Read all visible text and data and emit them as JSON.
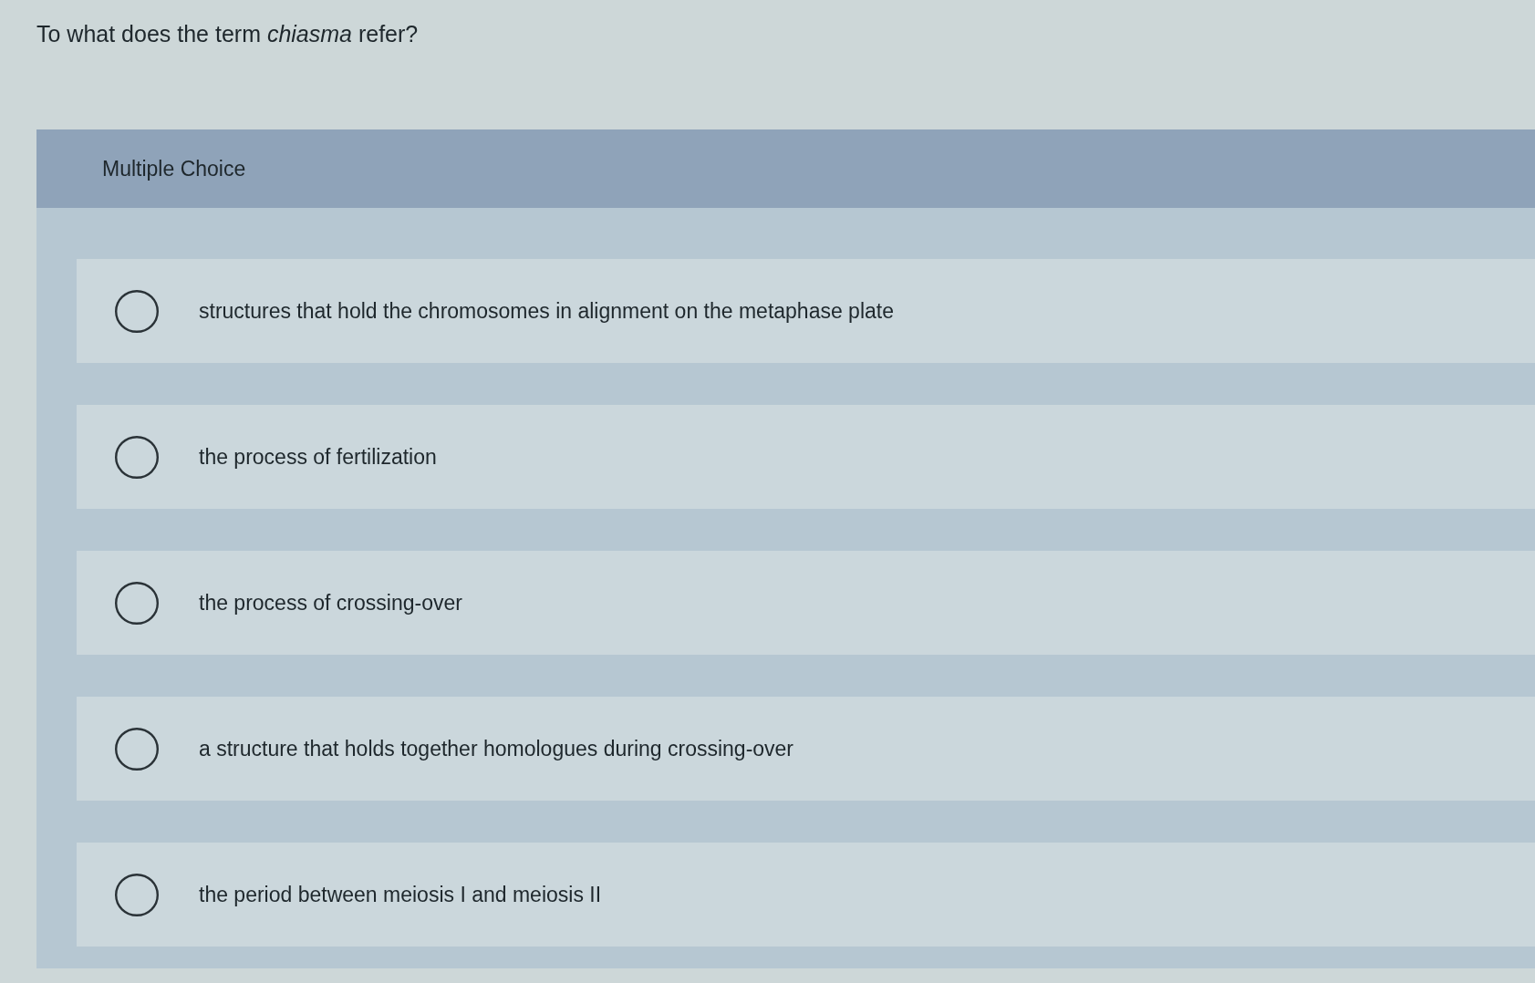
{
  "question": "To what does the term *chiasma* refer?",
  "panel": {
    "title": "Multiple Choice"
  },
  "options": [
    {
      "label": "structures that hold the chromosomes in alignment on the metaphase plate",
      "selected": false
    },
    {
      "label": "the process of fertilization",
      "selected": false
    },
    {
      "label": "the process of crossing-over",
      "selected": false
    },
    {
      "label": "a structure that holds together homologues during crossing-over",
      "selected": false
    },
    {
      "label": "the period between meiosis I and meiosis II",
      "selected": false
    }
  ]
}
